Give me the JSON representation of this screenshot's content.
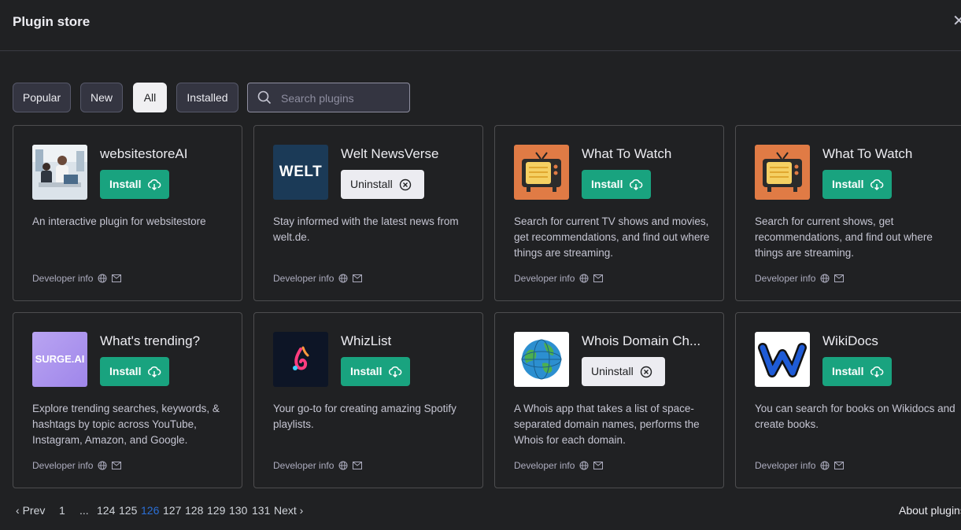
{
  "header": {
    "title": "Plugin store"
  },
  "filters": {
    "tabs": [
      {
        "label": "Popular"
      },
      {
        "label": "New"
      },
      {
        "label": "All"
      },
      {
        "label": "Installed"
      }
    ],
    "active_tab": "All",
    "search_placeholder": "Search plugins",
    "search_value": ""
  },
  "plugins": [
    {
      "name": "websitestoreAI",
      "action": "Install",
      "description": "An interactive plugin for websitestore",
      "developer": "Developer info"
    },
    {
      "name": "Welt NewsVerse",
      "action": "Uninstall",
      "description": "Stay informed with the latest news from welt.de.",
      "developer": "Developer info",
      "logo_text": "WELT"
    },
    {
      "name": "What To Watch",
      "action": "Install",
      "description": "Search for current TV shows and movies, get recommendations, and find out where things are streaming.",
      "developer": "Developer info"
    },
    {
      "name": "What To Watch",
      "action": "Install",
      "description": "Search for current shows, get recommendations, and find out where things are streaming.",
      "developer": "Developer info"
    },
    {
      "name": "What's trending?",
      "action": "Install",
      "description": "Explore trending searches, keywords, & hashtags by topic across YouTube, Instagram, Amazon, and Google.",
      "developer": "Developer info",
      "logo_text": "SURGE.AI"
    },
    {
      "name": "WhizList",
      "action": "Install",
      "description": "Your go-to for creating amazing Spotify playlists.",
      "developer": "Developer info"
    },
    {
      "name": "Whois Domain Ch...",
      "action": "Uninstall",
      "description": "A Whois app that takes a list of space-separated domain names, performs the Whois for each domain.",
      "developer": "Developer info"
    },
    {
      "name": "WikiDocs",
      "action": "Install",
      "description": "You can search for books on Wikidocs and create books.",
      "developer": "Developer info"
    }
  ],
  "pagination": {
    "prev": "Prev",
    "next": "Next",
    "pages": [
      "1",
      "...",
      "124",
      "125",
      "126",
      "127",
      "128",
      "129",
      "130",
      "131"
    ],
    "current": "126"
  },
  "footer": {
    "about": "About plugins"
  },
  "colors": {
    "background": "#202123",
    "install": "#19a37f",
    "current_page": "#2b6fd6"
  }
}
